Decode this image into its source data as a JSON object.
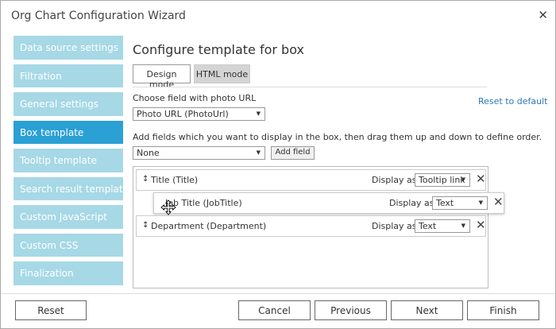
{
  "window": {
    "title": "Org Chart Configuration Wizard"
  },
  "sidebar": {
    "items": [
      {
        "label": "Data source settings"
      },
      {
        "label": "Filtration"
      },
      {
        "label": "General settings"
      },
      {
        "label": "Box template"
      },
      {
        "label": "Tooltip template"
      },
      {
        "label": "Search result template"
      },
      {
        "label": "Custom JavaScript"
      },
      {
        "label": "Custom CSS"
      },
      {
        "label": "Finalization"
      }
    ],
    "active_index": 3
  },
  "main": {
    "heading": "Configure template for box",
    "modes": {
      "design": "Design mode",
      "html": "HTML mode",
      "active": "design"
    },
    "photo_label": "Choose field with photo URL",
    "photo_select": "Photo URL (PhotoUrl)",
    "reset_link": "Reset to default",
    "add_label": "Add fields which you want to display in the box, then drag them up and down to define order.",
    "add_select": "None",
    "add_button": "Add field",
    "fields": [
      {
        "name": "Title (Title)",
        "display_label": "Display as:",
        "display_value": "Tooltip link"
      },
      {
        "name": "Job Title (JobTitle)",
        "display_label": "Display as:",
        "display_value": "Text",
        "dragging": true
      },
      {
        "name": "Department (Department)",
        "display_label": "Display as:",
        "display_value": "Text"
      }
    ]
  },
  "footer": {
    "reset": "Reset",
    "cancel": "Cancel",
    "previous": "Previous",
    "next": "Next",
    "finish": "Finish"
  },
  "icons": {
    "close": "close-icon",
    "drag_handle": "drag-handle-icon",
    "remove": "remove-icon",
    "move_cursor": "move-cursor-icon",
    "dropdown": "chevron-down-icon"
  },
  "colors": {
    "sidebar_item": "#a6d8e6",
    "sidebar_active": "#2aa0d4",
    "link": "#2a7ab8"
  }
}
